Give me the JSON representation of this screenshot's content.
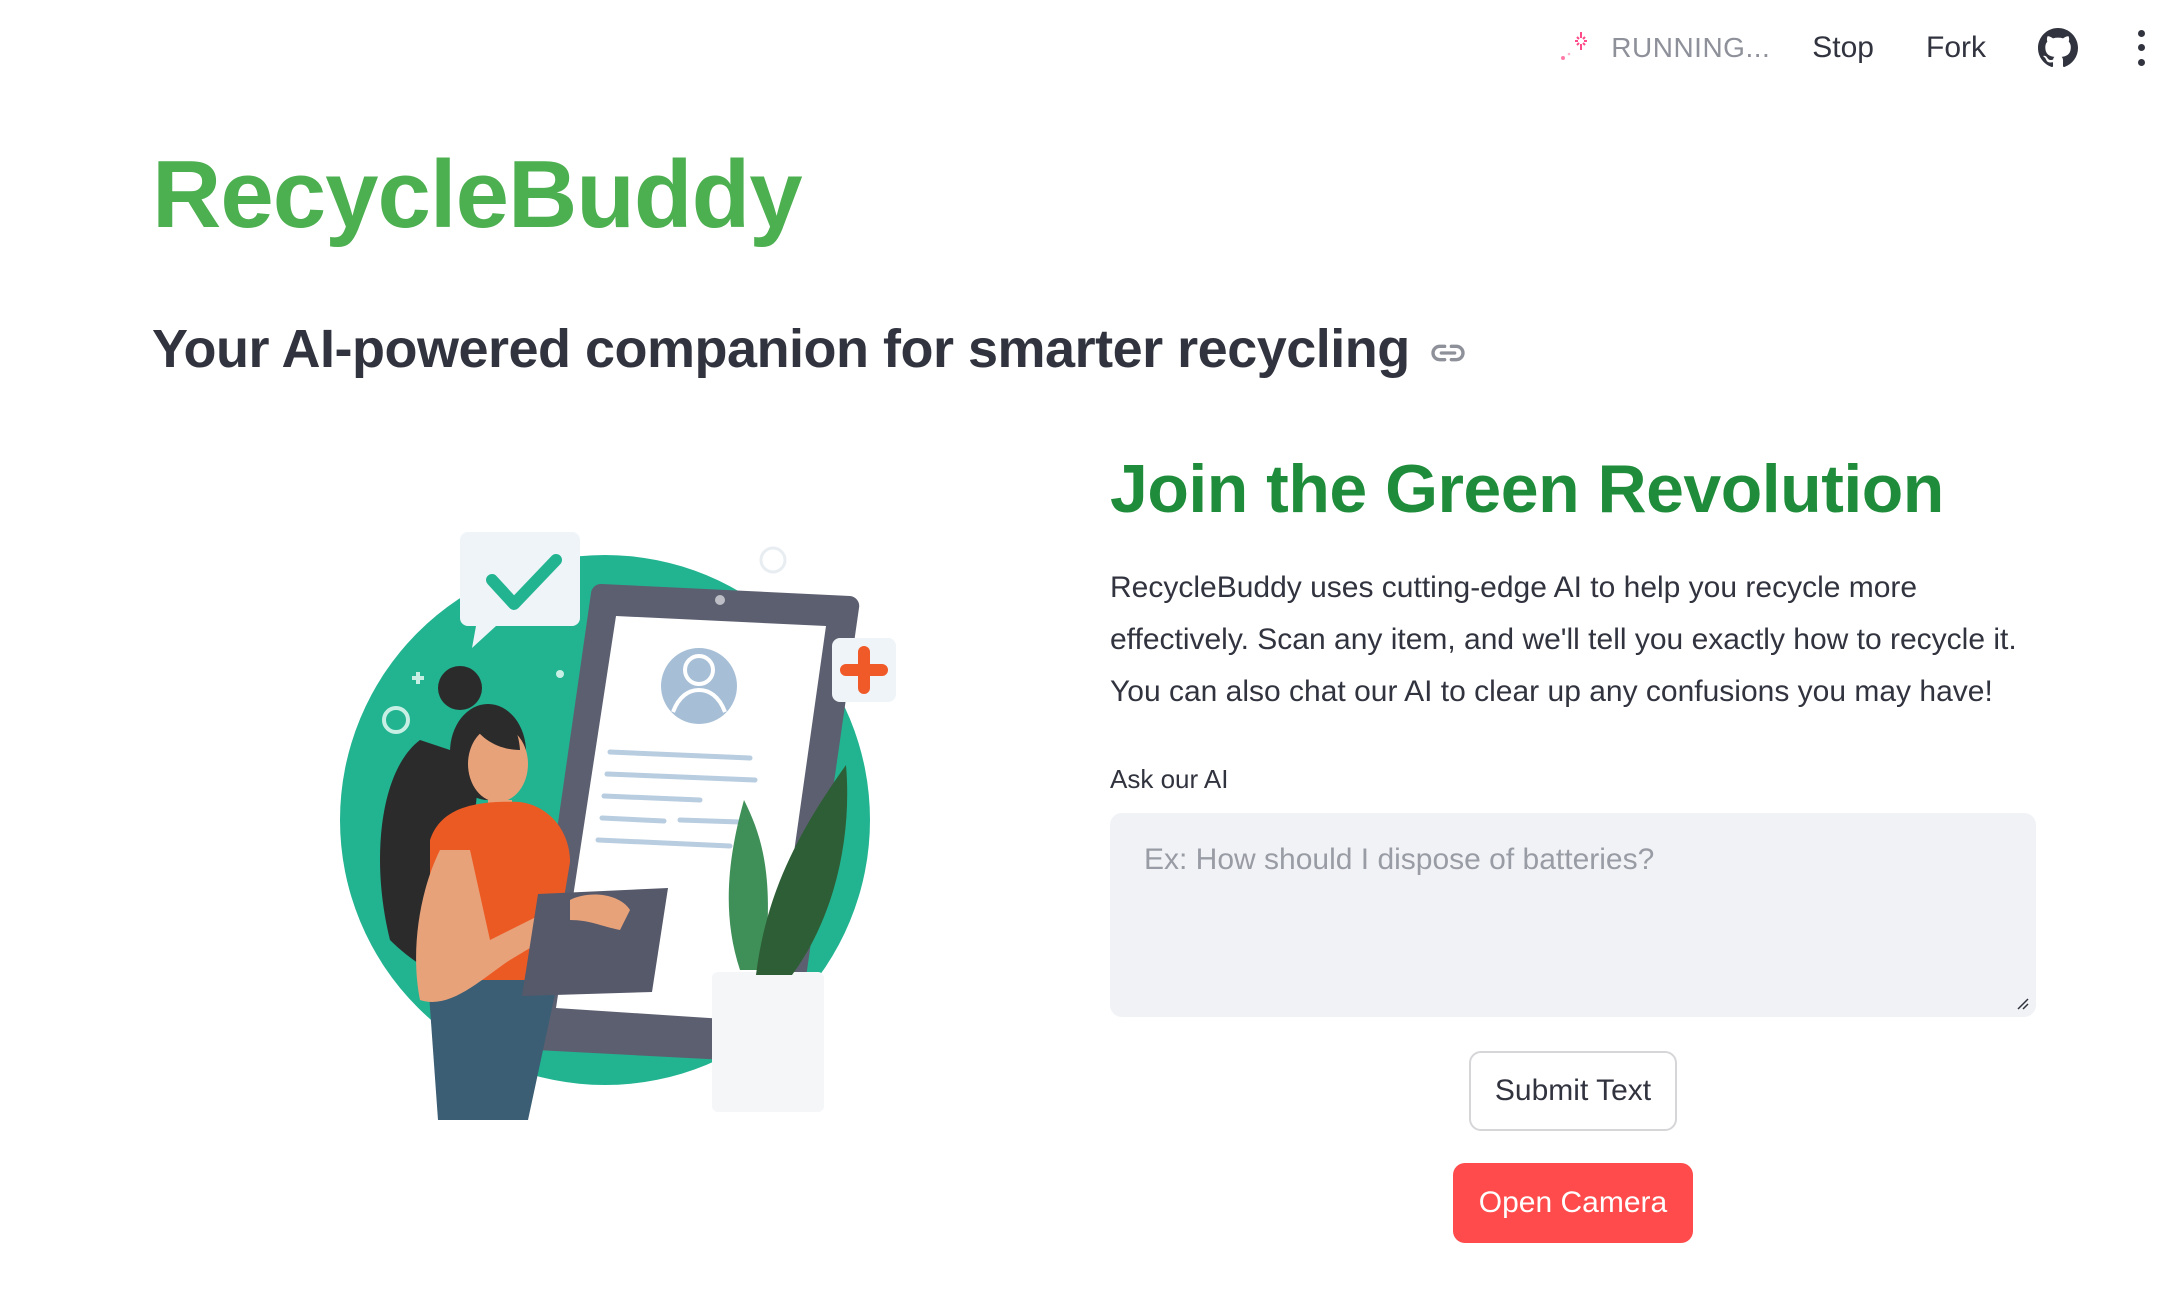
{
  "toolbar": {
    "status": "RUNNING...",
    "stop_label": "Stop",
    "fork_label": "Fork",
    "icons": [
      "running-icon",
      "github-icon",
      "more-menu-icon"
    ]
  },
  "header": {
    "title": "RecycleBuddy",
    "subtitle": "Your AI-powered companion for smarter recycling"
  },
  "main": {
    "section_title": "Join the Green Revolution",
    "description": "RecycleBuddy uses cutting-edge AI to help you recycle more effectively. Scan any item, and we'll tell you exactly how to recycle it. You can also chat our AI to clear up any confusions you may have!",
    "ask_label": "Ask our AI",
    "ask_placeholder": "Ex: How should I dispose of batteries?",
    "submit_label": "Submit Text",
    "camera_label": "Open Camera"
  },
  "colors": {
    "title_green": "#4caf50",
    "section_green": "#1e8c3a",
    "accent_red": "#ff4b4b",
    "illustration_teal": "#22b491"
  }
}
